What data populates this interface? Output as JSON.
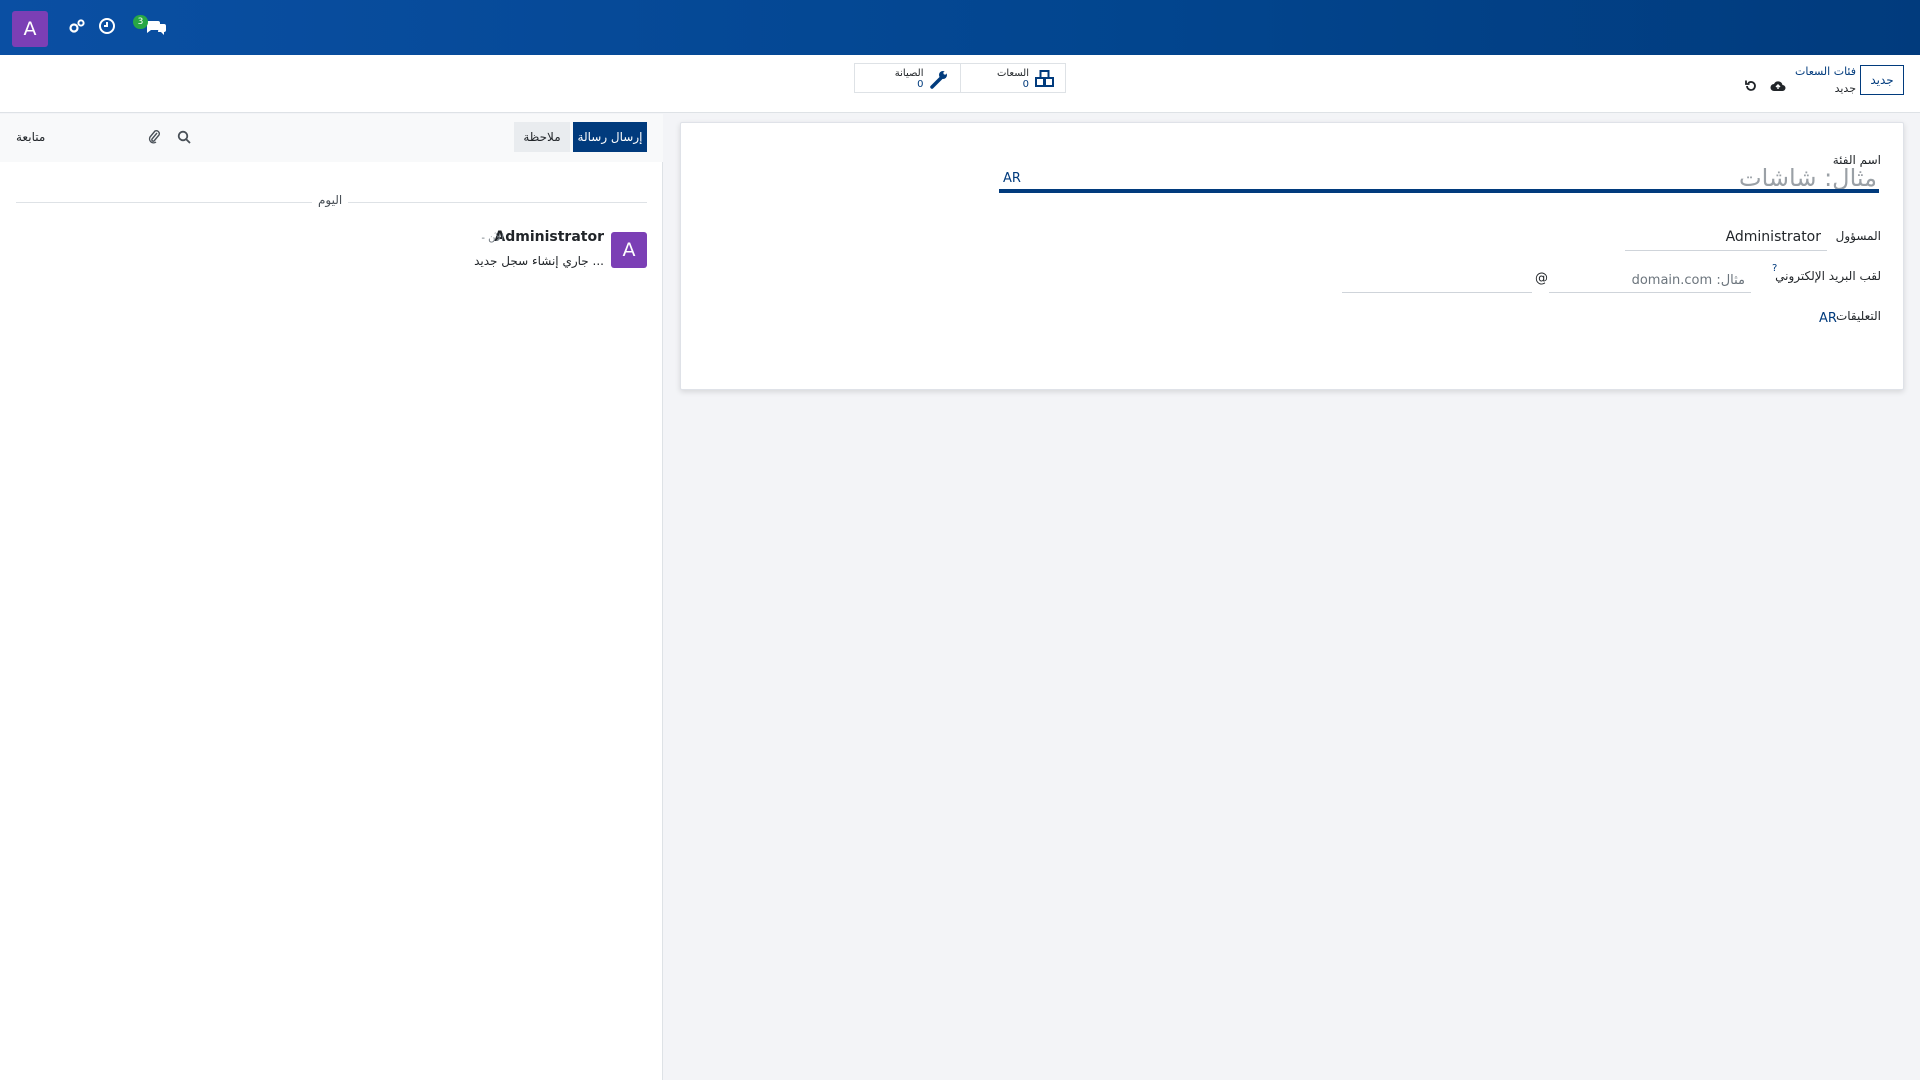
{
  "navbar": {
    "user_initial": "A",
    "chat_badge": "3",
    "icons": [
      "chat-icon",
      "clock-icon",
      "gears-icon"
    ]
  },
  "control_panel": {
    "new_button": "جديد",
    "breadcrumb_parent": "فئات السعات",
    "breadcrumb_current": "جديد",
    "smart_buttons": [
      {
        "label": "السعات",
        "value": "0",
        "icon": "cubes-icon"
      },
      {
        "label": "الصيانة",
        "value": "0",
        "icon": "wrench-icon"
      }
    ]
  },
  "form": {
    "name_label": "اسم الفئة",
    "name_placeholder": "مثال: شاشات",
    "name_lang": "AR",
    "responsible_label": "المسؤول",
    "responsible_value": "Administrator",
    "email_alias_label": "لقب البريد الإلكتروني",
    "email_alias_help": "?",
    "email_alias_placeholder": "مثال: domain.com",
    "at_symbol": "@",
    "comments_label": "التعليقات",
    "comments_lang": "AR"
  },
  "chatter": {
    "send_message": "إرسال رسالة",
    "log_note": "ملاحظة",
    "follow": "متابعة",
    "today": "اليوم",
    "message": {
      "avatar_initial": "A",
      "author": "Administrator",
      "time": "- الآن",
      "body": "جاري إنشاء سجل جديد ..."
    }
  },
  "colors": {
    "primary": "#013b7d",
    "avatar": "#7b3fb5",
    "badge": "#28a745"
  }
}
